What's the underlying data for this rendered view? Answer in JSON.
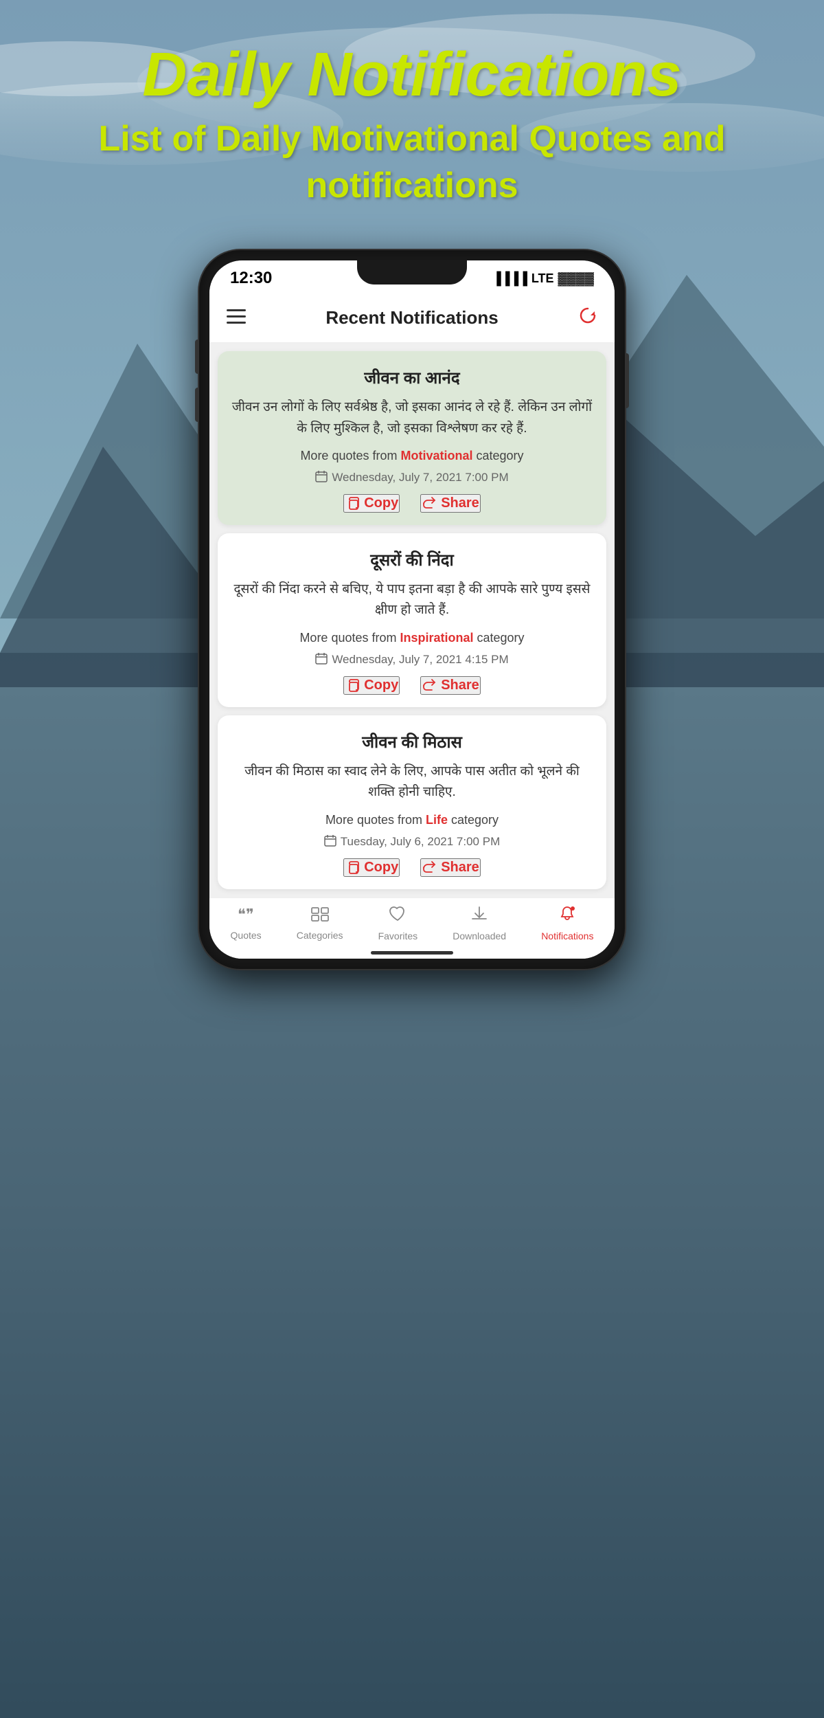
{
  "header": {
    "main_title": "Daily Notifications",
    "subtitle": "List of Daily Motivational Quotes and notifications"
  },
  "phone": {
    "status_bar": {
      "time": "12:30",
      "signal": "▐▐▐▐",
      "network": "LTE",
      "battery": "█████"
    },
    "app_header": {
      "title": "Recent Notifications"
    },
    "quotes": [
      {
        "id": 1,
        "title": "जीवन का आनंद",
        "text": "जीवन उन लोगों के लिए सर्वश्रेष्ठ है, जो इसका आनंद ले रहे हैं. लेकिन उन लोगों के लिए मुश्किल है, जो इसका विश्लेषण कर रहे हैं.",
        "more_quotes_prefix": "More quotes from ",
        "category": "Motivational",
        "more_quotes_suffix": " category",
        "date": "Wednesday, July 7, 2021 7:00 PM",
        "copy_label": "Copy",
        "share_label": "Share",
        "card_style": "green"
      },
      {
        "id": 2,
        "title": "दूसरों की निंदा",
        "text": "दूसरों की निंदा करने से बचिए, ये पाप इतना बड़ा है की आपके सारे पुण्य इससे क्षीण हो जाते हैं.",
        "more_quotes_prefix": "More quotes from ",
        "category": "Inspirational",
        "more_quotes_suffix": " category",
        "date": "Wednesday, July 7, 2021 4:15 PM",
        "copy_label": "Copy",
        "share_label": "Share",
        "card_style": "white"
      },
      {
        "id": 3,
        "title": "जीवन की मिठास",
        "text": "जीवन की मिठास का स्वाद लेने के लिए, आपके पास अतीत को भूलने की शक्ति होनी चाहिए.",
        "more_quotes_prefix": "More quotes from ",
        "category": "Life",
        "more_quotes_suffix": " category",
        "date": "Tuesday, July 6, 2021 7:00 PM",
        "copy_label": "Copy",
        "share_label": "Share",
        "card_style": "white"
      }
    ],
    "bottom_nav": [
      {
        "id": "quotes",
        "label": "Quotes",
        "icon": "❝❞",
        "active": false
      },
      {
        "id": "categories",
        "label": "Categories",
        "icon": "≡",
        "active": false
      },
      {
        "id": "favorites",
        "label": "Favorites",
        "icon": "♡",
        "active": false
      },
      {
        "id": "downloaded",
        "label": "Downloaded",
        "icon": "↓",
        "active": false
      },
      {
        "id": "notifications",
        "label": "Notifications",
        "icon": "🔔",
        "active": true
      }
    ]
  }
}
